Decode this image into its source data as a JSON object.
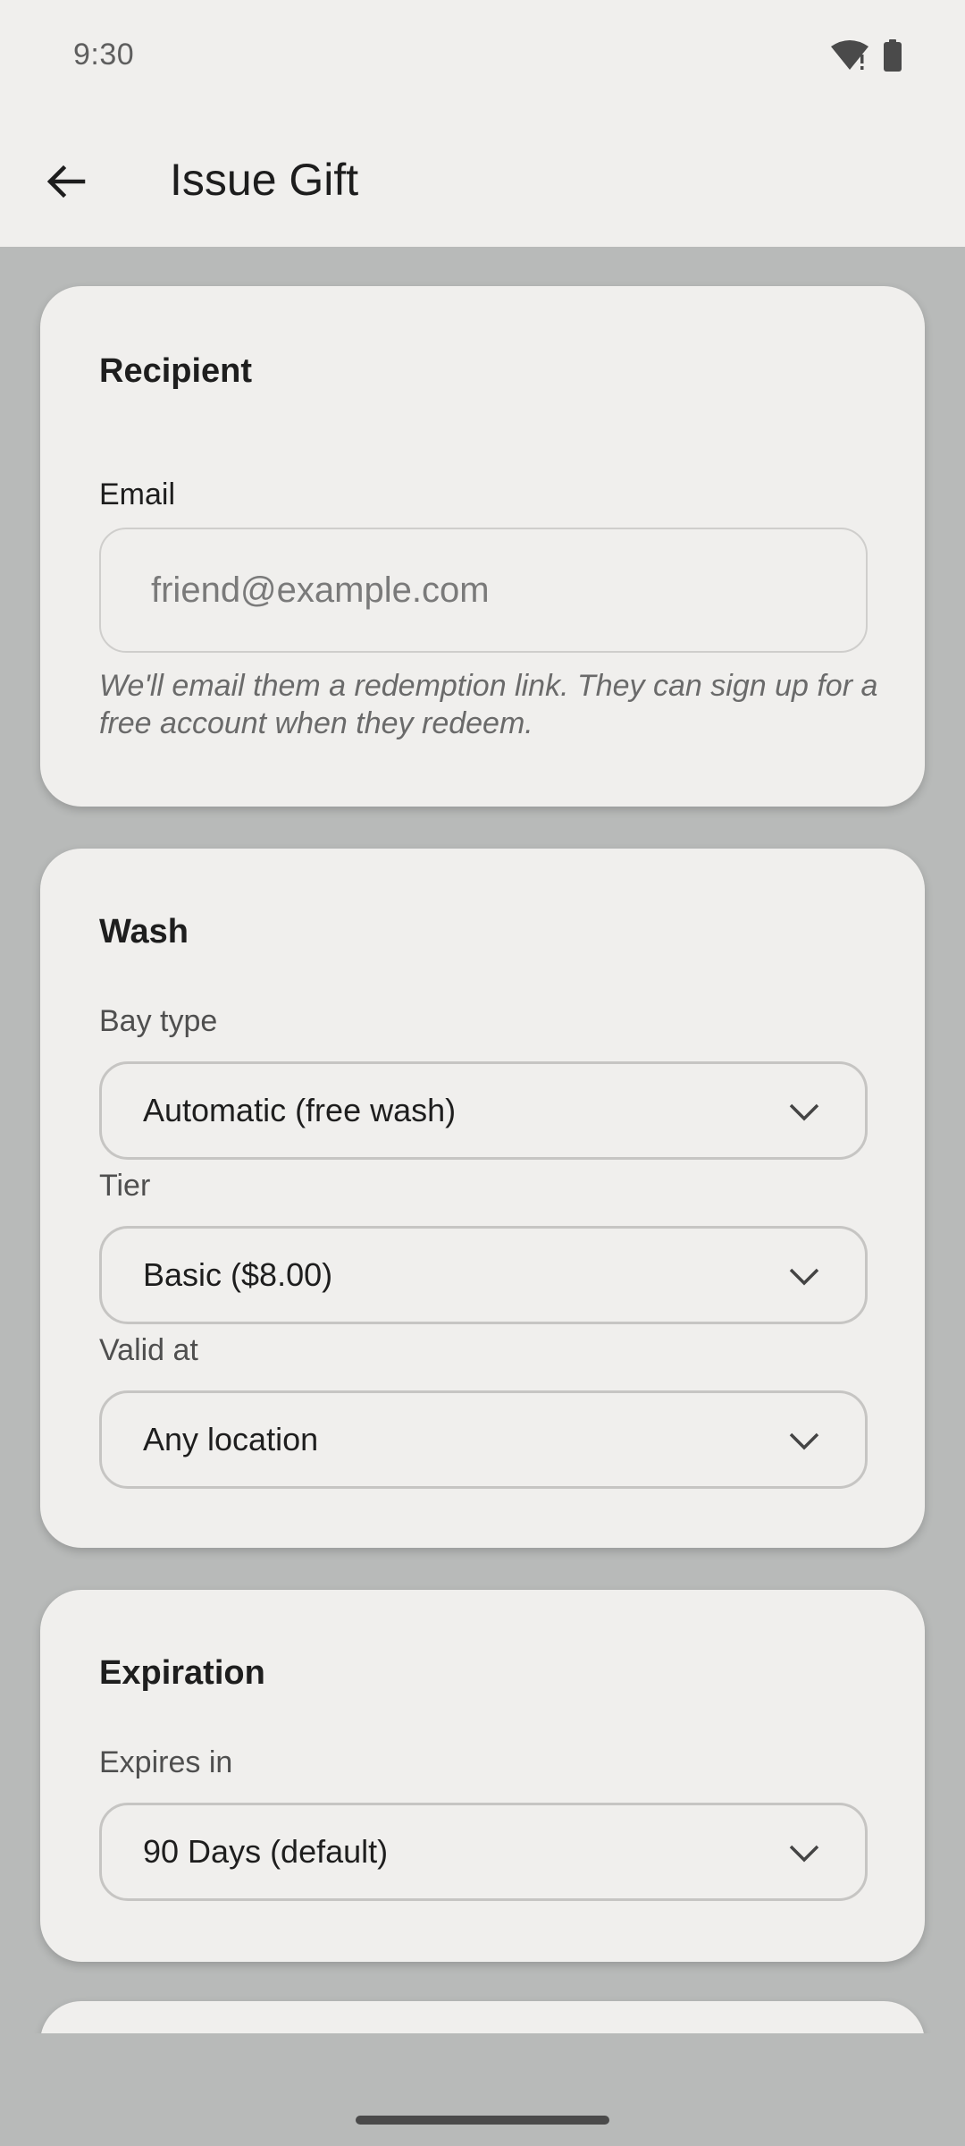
{
  "status_bar": {
    "time": "9:30",
    "icons": [
      "wifi-alert-icon",
      "battery-icon"
    ]
  },
  "app_bar": {
    "back_icon": "arrow-left-icon",
    "title": "Issue Gift"
  },
  "recipient": {
    "title": "Recipient",
    "email_label": "Email",
    "email_value": "",
    "email_placeholder": "friend@example.com",
    "helper": "We'll email them a redemption link. They can sign up for a free account when they redeem."
  },
  "wash": {
    "title": "Wash",
    "bay_type_label": "Bay type",
    "bay_type_value": "Automatic (free wash)",
    "tier_label": "Tier",
    "tier_value": "Basic ($8.00)",
    "valid_at_label": "Valid at",
    "valid_at_value": "Any location"
  },
  "expiration": {
    "title": "Expiration",
    "expires_in_label": "Expires in",
    "expires_in_value": "90 Days (default)"
  },
  "colors": {
    "surface": "#f0efed",
    "background": "#b8bab9",
    "text_primary": "#1c1c1c",
    "text_secondary": "#4f4f4f"
  }
}
